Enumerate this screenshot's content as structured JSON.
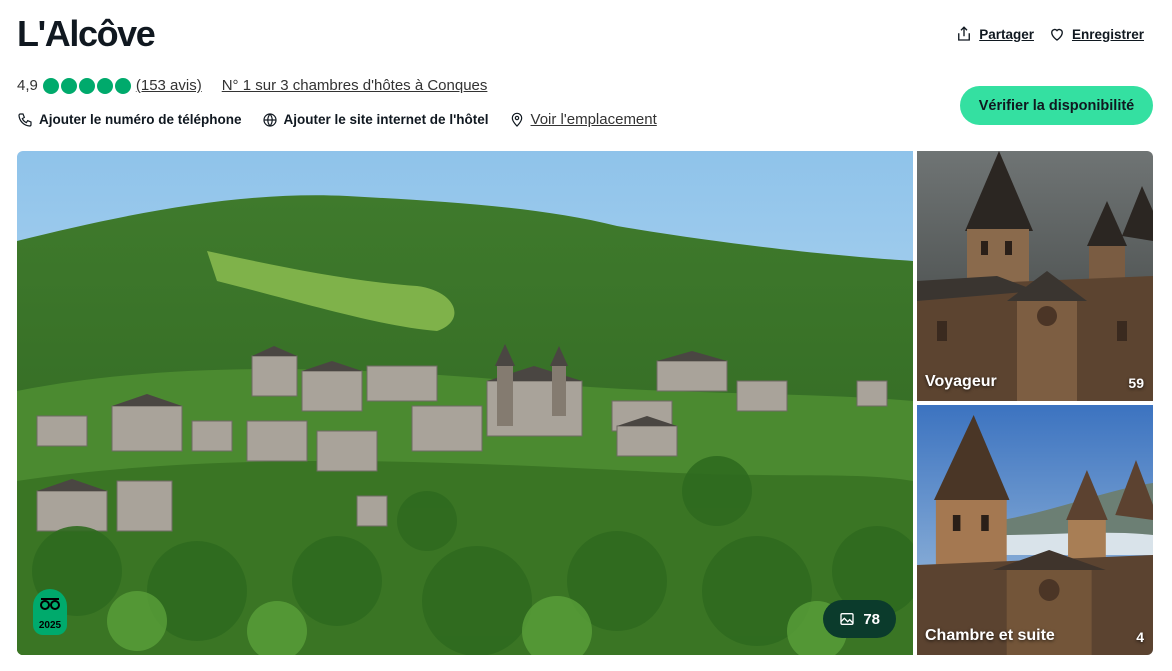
{
  "hotel": {
    "name": "L'Alcôve",
    "rating_value": "4,9",
    "rating_bubbles": 5,
    "reviews_link": "(153 avis)",
    "rank_link": "N° 1 sur 3 chambres d'hôtes à Conques"
  },
  "actions": {
    "share_label": "Partager",
    "save_label": "Enregistrer"
  },
  "contact": {
    "phone_label": "Ajouter le numéro de téléphone",
    "website_label": "Ajouter le site internet de l'hôtel",
    "location_label": "Voir l'emplacement"
  },
  "cta": {
    "check_availability": "Vérifier la disponibilité",
    "color": "#34e0a1"
  },
  "gallery": {
    "main_photo_count": "78",
    "award_year": "2025",
    "side_photos": [
      {
        "label": "Voyageur",
        "count": "59"
      },
      {
        "label": "Chambre et suite",
        "count": "4"
      }
    ]
  },
  "colors": {
    "brand_green": "#00aa6c",
    "photo_badge": "#0b3b2c"
  }
}
